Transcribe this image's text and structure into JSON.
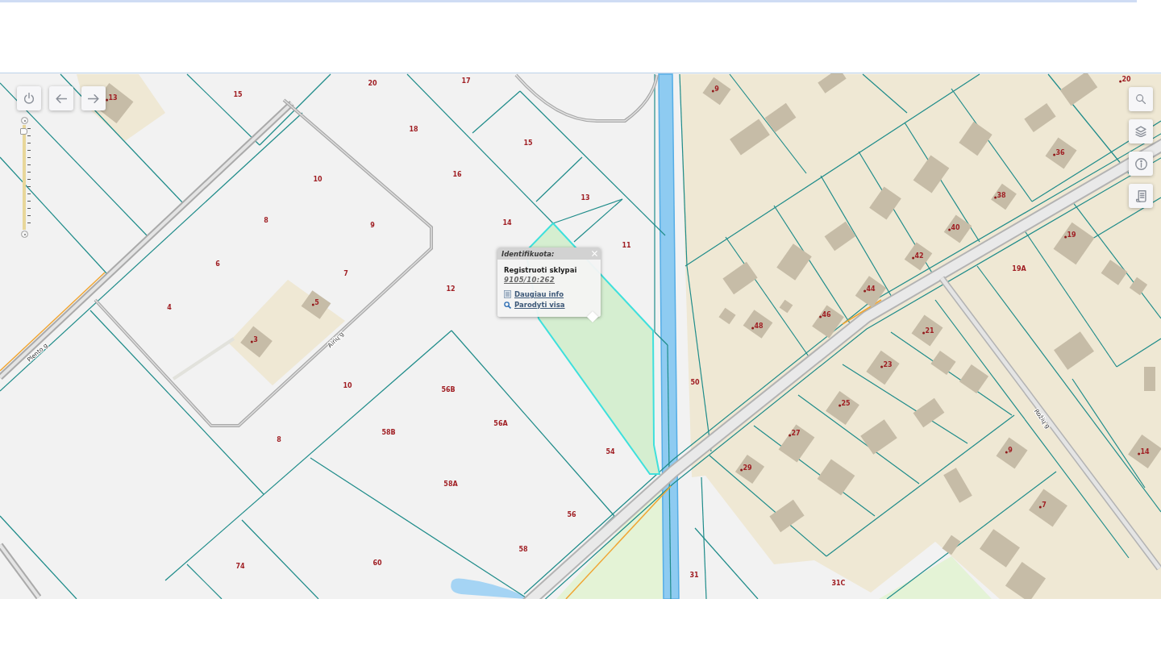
{
  "map": {
    "parcel_numbers": [
      "13",
      "15",
      "20",
      "17",
      "18",
      "15",
      "16",
      "10",
      "13",
      "8",
      "9",
      "14",
      "11",
      "6",
      "7",
      "12",
      "4",
      "5",
      "3",
      "10",
      "56B",
      "56A",
      "58B",
      "8",
      "54",
      "58A",
      "56",
      "58",
      "74",
      "60",
      "9",
      "20",
      "36",
      "38",
      "40",
      "19",
      "42",
      "19A",
      "44",
      "46",
      "48",
      "21",
      "23",
      "50",
      "25",
      "27",
      "9",
      "14",
      "29",
      "7",
      "31",
      "31C"
    ],
    "street_names": [
      "Plento g",
      "Airių g",
      "Rožių g"
    ],
    "zoom_slider": {
      "level": 0.97
    }
  },
  "popup": {
    "title": "Identifikuota:",
    "layer": "Registruoti sklypai",
    "parcel_id": "9105/10:262",
    "links": [
      {
        "kind": "details",
        "label": "Daugiau info"
      },
      {
        "kind": "show",
        "label": "Parodyti visa"
      }
    ]
  }
}
